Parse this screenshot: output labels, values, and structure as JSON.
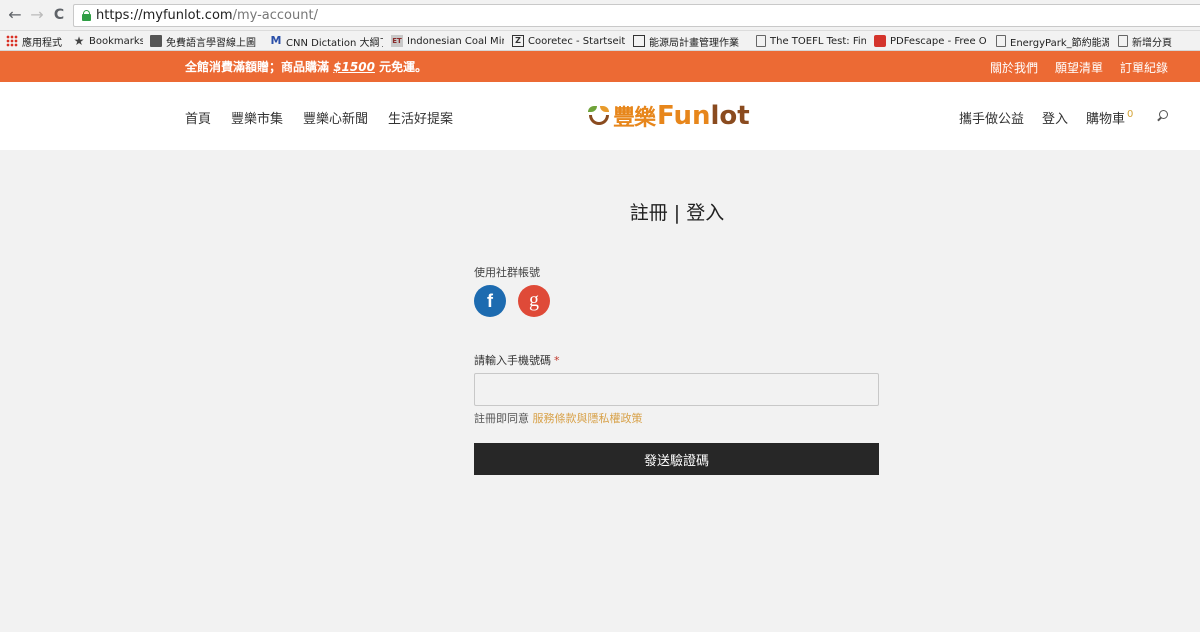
{
  "browser": {
    "back_icon": "←",
    "forward_icon": "→",
    "reload_icon": "C",
    "url_host": "https://myfunlot.com",
    "url_path": "/my-account/",
    "bookmarks": [
      {
        "label": "應用程式",
        "icon": "apps-grid-icon"
      },
      {
        "label": "Bookmarks",
        "icon": "star-icon"
      },
      {
        "label": "免費語言學習線上圖",
        "icon": "image-icon"
      },
      {
        "label": "CNN Dictation 大綱了",
        "icon": "m-logo-icon"
      },
      {
        "label": "Indonesian Coal Min",
        "icon": "et-logo-icon"
      },
      {
        "label": "Cooretec - Startseite",
        "icon": "z-logo-icon"
      },
      {
        "label": "能源局計畫管理作業",
        "icon": "chart-icon"
      },
      {
        "label": "The TOEFL Test: Find",
        "icon": "document-icon"
      },
      {
        "label": "PDFescape - Free On",
        "icon": "pdf-icon"
      },
      {
        "label": "EnergyPark_節約能源",
        "icon": "document-icon"
      },
      {
        "label": "新增分頁",
        "icon": "document-icon"
      }
    ]
  },
  "promo": {
    "text_before": "全館消費滿額贈；商品購滿 ",
    "amount": "$1500",
    "text_after": " 元免運。",
    "links": [
      "關於我們",
      "願望清單",
      "訂單紀錄"
    ]
  },
  "nav": {
    "left": [
      "首頁",
      "豐樂市集",
      "豐樂心新聞",
      "生活好提案"
    ],
    "logo_zh": "豐樂",
    "logo_en_f": "Fun",
    "logo_en_l": "lot",
    "charity": "攜手做公益",
    "login": "登入",
    "cart": "購物車",
    "cart_count": "0"
  },
  "main": {
    "title": "註冊 | 登入",
    "social_label": "使用社群帳號",
    "facebook_glyph": "f",
    "google_glyph": "g",
    "phone_label": "請輸入手機號碼",
    "required_mark": "*",
    "phone_value": "",
    "terms_prefix": "註冊即同意 ",
    "terms_link": "服務條款與隱私權政策",
    "send_button": "發送驗證碼"
  },
  "colors": {
    "promo_bg": "#ec6a34",
    "button_bg": "#272727",
    "link_accent": "#d8a24a",
    "facebook": "#1d6bb0",
    "google": "#df4a38"
  }
}
